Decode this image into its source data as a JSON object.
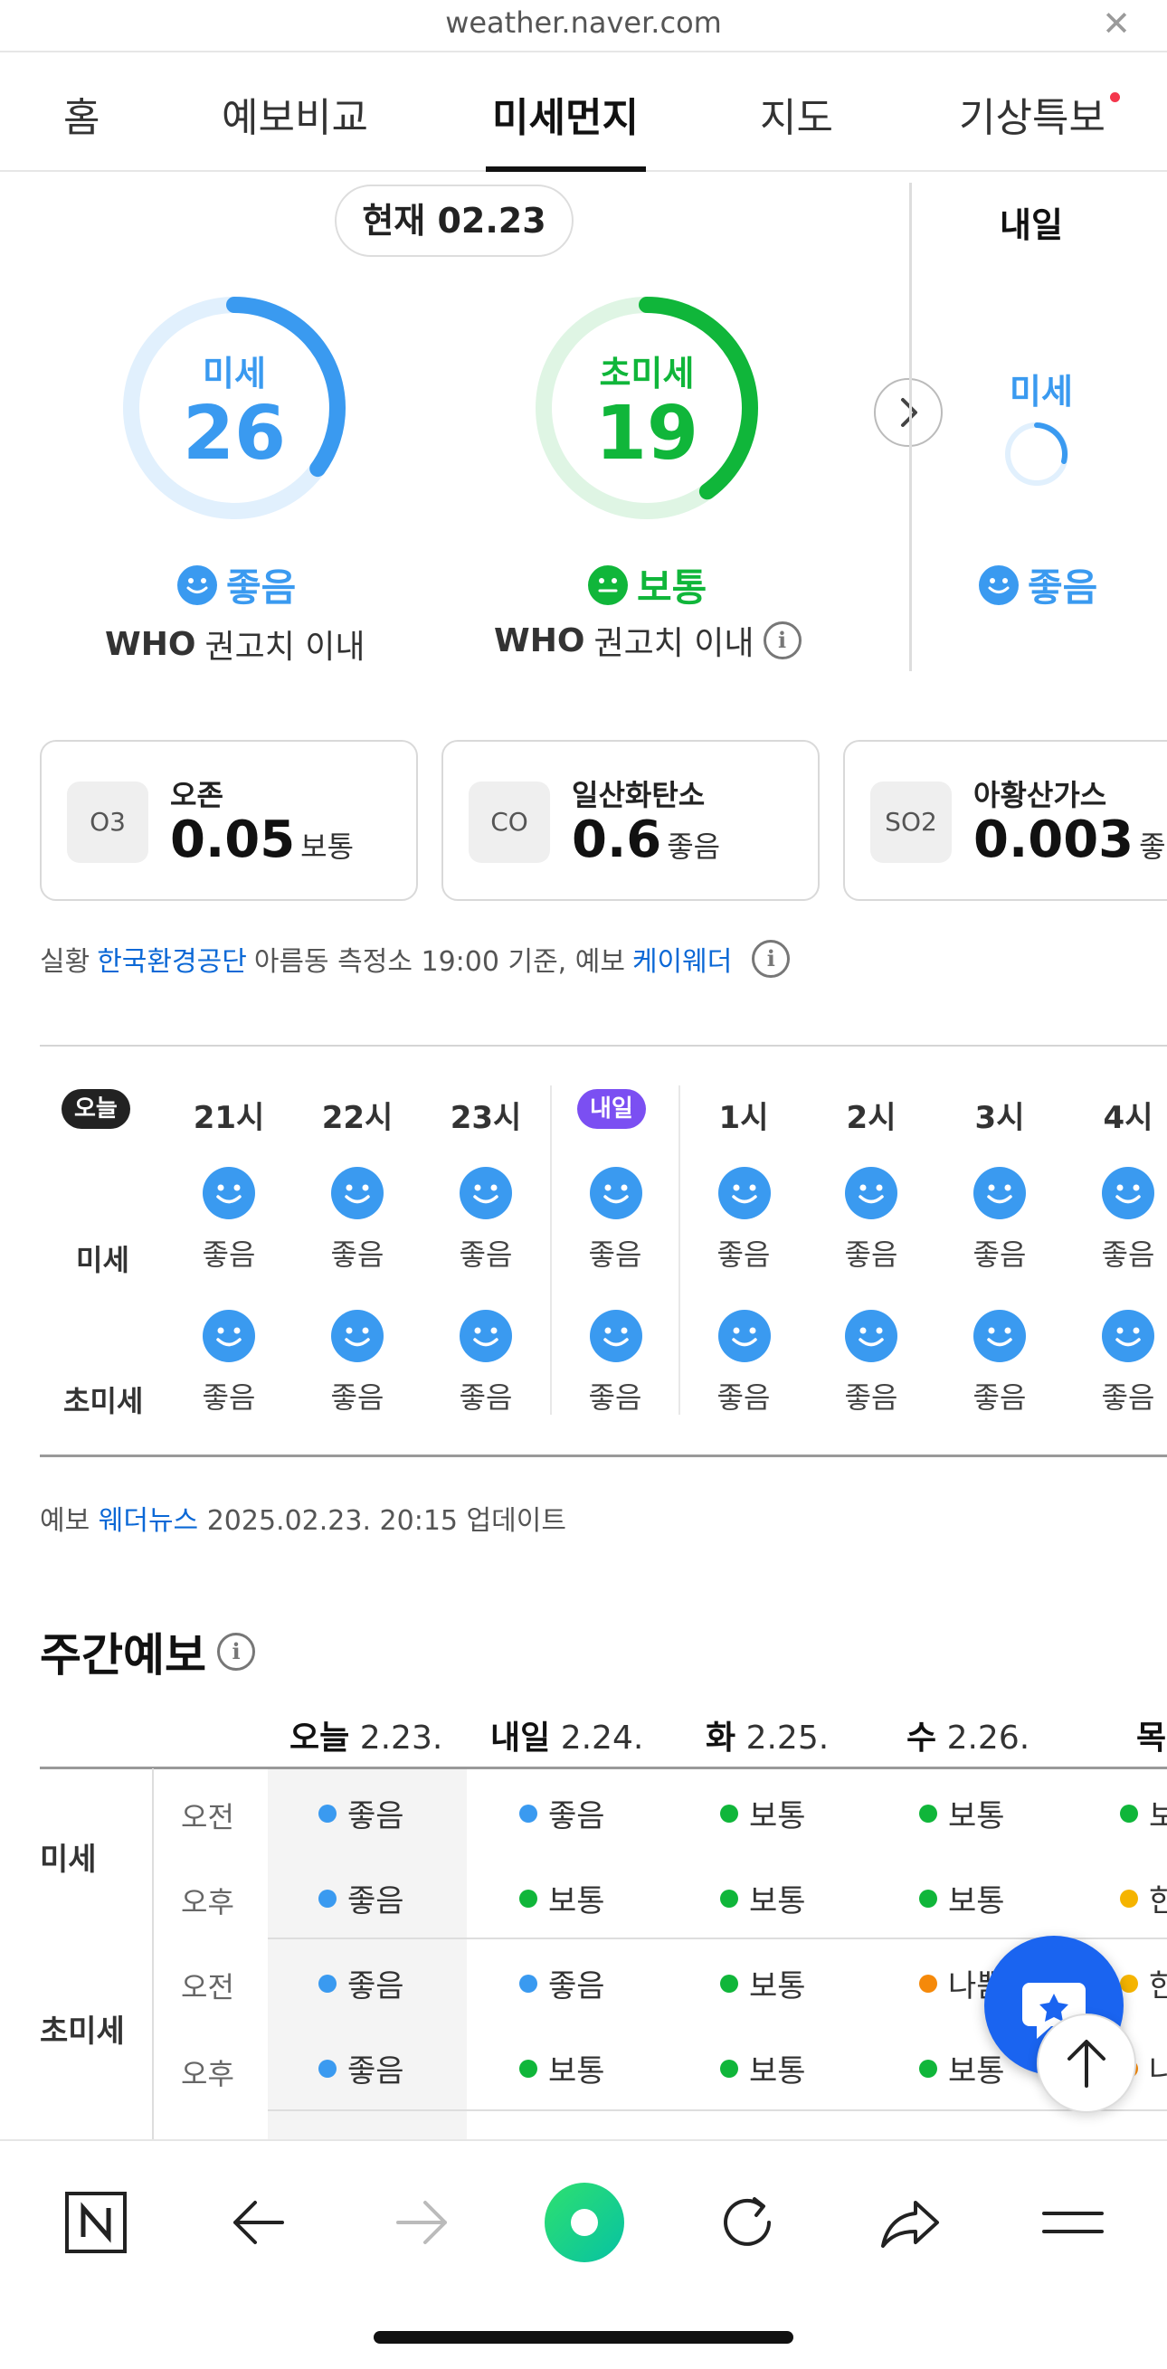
{
  "browser": {
    "url": "weather.naver.com"
  },
  "tabs": [
    {
      "label": "홈"
    },
    {
      "label": "예보비교"
    },
    {
      "label": "미세먼지"
    },
    {
      "label": "지도"
    },
    {
      "label": "기상특보"
    }
  ],
  "current": {
    "date_pill": "현재 02.23",
    "pm10": {
      "label": "미세",
      "value": "26",
      "status": "좋음",
      "who_bold": "WHO",
      "who_text": "권고치 이내",
      "level": 0.35
    },
    "pm25": {
      "label": "초미세",
      "value": "19",
      "status": "보통",
      "who_bold": "WHO",
      "who_text": "권고치 이내",
      "level": 0.4
    },
    "tomorrow": {
      "heading": "내일",
      "label": "미세",
      "status": "좋음"
    }
  },
  "pollutants": [
    {
      "code": "O3",
      "name": "오존",
      "value": "0.05",
      "grade": "보통"
    },
    {
      "code": "CO",
      "name": "일산화탄소",
      "value": "0.6",
      "grade": "좋음"
    },
    {
      "code": "SO2",
      "name": "아황산가스",
      "value": "0.003",
      "grade": "좋음"
    }
  ],
  "source": {
    "prefix": "실황",
    "agency": "한국환경공단",
    "middle": "아름동 측정소 19:00 기준, 예보",
    "forecaster": "케이웨더"
  },
  "hourly": {
    "today_badge": "오늘",
    "tomorrow_badge": "내일",
    "row_pm10": "미세",
    "row_pm25": "초미세",
    "columns": [
      {
        "time": "21시",
        "pm10": "좋음",
        "pm25": "좋음"
      },
      {
        "time": "22시",
        "pm10": "좋음",
        "pm25": "좋음"
      },
      {
        "time": "23시",
        "pm10": "좋음",
        "pm25": "좋음"
      },
      {
        "time": "",
        "pm10": "좋음",
        "pm25": "좋음"
      },
      {
        "time": "1시",
        "pm10": "좋음",
        "pm25": "좋음"
      },
      {
        "time": "2시",
        "pm10": "좋음",
        "pm25": "좋음"
      },
      {
        "time": "3시",
        "pm10": "좋음",
        "pm25": "좋음"
      },
      {
        "time": "4시",
        "pm10": "좋음",
        "pm25": "좋음"
      }
    ]
  },
  "update": {
    "prefix": "예보",
    "source": "웨더뉴스",
    "text": "2025.02.23. 20:15 업데이트"
  },
  "weekly": {
    "title": "주간예보",
    "days": [
      {
        "day": "오늘",
        "date": "2.23."
      },
      {
        "day": "내일",
        "date": "2.24."
      },
      {
        "day": "화",
        "date": "2.25."
      },
      {
        "day": "수",
        "date": "2.26."
      },
      {
        "day": "목",
        "date": ""
      }
    ],
    "row_pm10": "미세",
    "row_pm25": "초미세",
    "am": "오전",
    "pm": "오후",
    "grid": [
      [
        {
          "s": "좋음",
          "c": "#3a9af0"
        },
        {
          "s": "좋음",
          "c": "#3a9af0"
        },
        {
          "s": "보통",
          "c": "#10b63a"
        },
        {
          "s": "보통",
          "c": "#10b63a"
        },
        {
          "s": "보",
          "c": "#10b63a"
        }
      ],
      [
        {
          "s": "좋음",
          "c": "#3a9af0"
        },
        {
          "s": "보통",
          "c": "#10b63a"
        },
        {
          "s": "보통",
          "c": "#10b63a"
        },
        {
          "s": "보통",
          "c": "#10b63a"
        },
        {
          "s": "한",
          "c": "#f5b400"
        }
      ],
      [
        {
          "s": "좋음",
          "c": "#3a9af0"
        },
        {
          "s": "좋음",
          "c": "#3a9af0"
        },
        {
          "s": "보통",
          "c": "#10b63a"
        },
        {
          "s": "나쁨",
          "c": "#f5890a"
        },
        {
          "s": "한",
          "c": "#f5b400"
        }
      ],
      [
        {
          "s": "좋음",
          "c": "#3a9af0"
        },
        {
          "s": "보통",
          "c": "#10b63a"
        },
        {
          "s": "보통",
          "c": "#10b63a"
        },
        {
          "s": "보통",
          "c": "#10b63a"
        },
        {
          "s": "나",
          "c": "#f5890a"
        }
      ]
    ]
  },
  "colors": {
    "good": "#3a9af0",
    "normal": "#10b63a",
    "tomorrow_badge": "#7b4ff2",
    "link": "#0b68d6"
  }
}
